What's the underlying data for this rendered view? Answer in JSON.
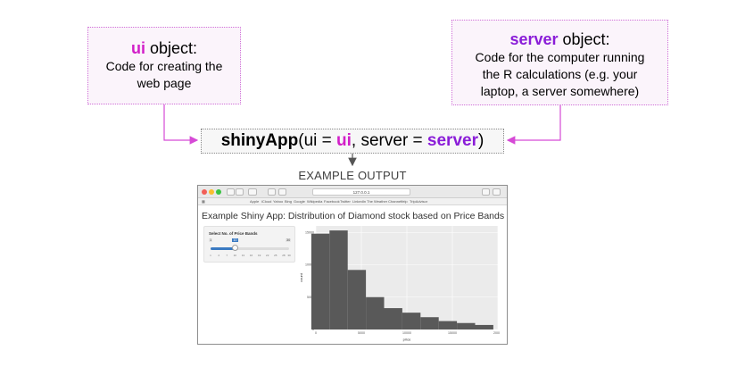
{
  "ui_box": {
    "keyword": "ui",
    "title_rest": " object:",
    "text_line1": "Code for creating the",
    "text_line2": "web page"
  },
  "server_box": {
    "keyword": "server",
    "title_rest": " object:",
    "text_line1": "Code for the computer running",
    "text_line2": "the R calculations (e.g. your",
    "text_line3": "laptop, a server somewhere)"
  },
  "call": {
    "fn": "shinyApp",
    "open": "(ui = ",
    "ui_arg": "ui",
    "mid": ", server = ",
    "server_arg": "server",
    "close": ")"
  },
  "example_label": "EXAMPLE OUTPUT",
  "colors": {
    "ui_keyword": "#d21ec8",
    "server_keyword": "#8a1dd8",
    "arrow": "#d64ad6",
    "bars": "#595959",
    "plot_panel": "#ebebeb"
  },
  "browser": {
    "url": "127.0.0.1",
    "bookmarks": [
      "Apple",
      "iCloud",
      "Yahoo",
      "Bing",
      "Google",
      "Wikipedia",
      "Facebook",
      "Twitter",
      "LinkedIn",
      "The Weather Channel",
      "Yelp",
      "TripAdvisor"
    ]
  },
  "app": {
    "title": "Example Shiny App: Distribution of Diamond stock based on Price Bands",
    "slider": {
      "label": "Select No. of Price Bands",
      "min": 1,
      "max": 30,
      "value": 10,
      "ticks": [
        "1",
        "4",
        "7",
        "10",
        "13",
        "16",
        "19",
        "22",
        "25",
        "28",
        "30"
      ]
    }
  },
  "chart_data": {
    "type": "bar",
    "title": "",
    "xlabel": "price",
    "ylabel": "count",
    "x_ticks": [
      "0",
      "5000",
      "10000",
      "15000",
      "20000"
    ],
    "y_ticks": [
      "0",
      "5000",
      "10000",
      "15000"
    ],
    "xlim": [
      0,
      20000
    ],
    "ylim": [
      0,
      16000
    ],
    "bin_edges": [
      -500,
      1500,
      3500,
      5500,
      7500,
      9500,
      11500,
      13500,
      15500,
      17500,
      19500
    ],
    "values": [
      14800,
      15300,
      9200,
      5000,
      3300,
      2600,
      1900,
      1300,
      1000,
      700
    ],
    "grid": true
  }
}
